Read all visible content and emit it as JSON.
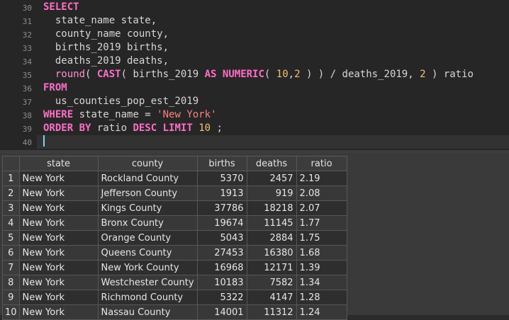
{
  "editor": {
    "line_numbers": [
      "30",
      "31",
      "32",
      "33",
      "34",
      "35",
      "36",
      "37",
      "38",
      "39",
      "40"
    ],
    "lines": {
      "l30": {
        "kw": "SELECT"
      },
      "l31": {
        "text": "  state_name state,"
      },
      "l32": {
        "text": "  county_name county,"
      },
      "l33": {
        "text": "  births_2019 births,"
      },
      "l34": {
        "text": "  deaths_2019 deaths,"
      },
      "l35": {
        "p1": "  ",
        "fn": "round",
        "p2": "( ",
        "kw1": "CAST",
        "p3": "( births_2019 ",
        "kw2": "AS",
        "p4": " ",
        "kw3": "NUMERIC",
        "p5": "( ",
        "n1": "10",
        "p6": ",",
        "n2": "2",
        "p7": " ) ) / deaths_2019, ",
        "n3": "2",
        "p8": " ) ratio"
      },
      "l36": {
        "kw": "FROM"
      },
      "l37": {
        "text": "  us_counties_pop_est_2019"
      },
      "l38": {
        "kw": "WHERE",
        "mid": " state_name = ",
        "str": "'New York'"
      },
      "l39": {
        "kw1": "ORDER BY",
        "mid": " ratio ",
        "kw2": "DESC",
        "sp": " ",
        "kw3": "LIMIT",
        "sp2": " ",
        "num": "10",
        "end": " ;"
      }
    }
  },
  "results": {
    "columns": [
      "state",
      "county",
      "births",
      "deaths",
      "ratio"
    ],
    "rows": [
      {
        "n": "1",
        "state": "New York",
        "county": "Rockland County",
        "births": "5370",
        "deaths": "2457",
        "ratio": "2.19"
      },
      {
        "n": "2",
        "state": "New York",
        "county": "Jefferson County",
        "births": "1913",
        "deaths": "919",
        "ratio": "2.08"
      },
      {
        "n": "3",
        "state": "New York",
        "county": "Kings County",
        "births": "37786",
        "deaths": "18218",
        "ratio": "2.07"
      },
      {
        "n": "4",
        "state": "New York",
        "county": "Bronx County",
        "births": "19674",
        "deaths": "11145",
        "ratio": "1.77"
      },
      {
        "n": "5",
        "state": "New York",
        "county": "Orange County",
        "births": "5043",
        "deaths": "2884",
        "ratio": "1.75"
      },
      {
        "n": "6",
        "state": "New York",
        "county": "Queens County",
        "births": "27453",
        "deaths": "16380",
        "ratio": "1.68"
      },
      {
        "n": "7",
        "state": "New York",
        "county": "New York County",
        "births": "16968",
        "deaths": "12171",
        "ratio": "1.39"
      },
      {
        "n": "8",
        "state": "New York",
        "county": "Westchester County",
        "births": "10183",
        "deaths": "7582",
        "ratio": "1.34"
      },
      {
        "n": "9",
        "state": "New York",
        "county": "Richmond County",
        "births": "5322",
        "deaths": "4147",
        "ratio": "1.28"
      },
      {
        "n": "10",
        "state": "New York",
        "county": "Nassau County",
        "births": "14001",
        "deaths": "11312",
        "ratio": "1.24"
      }
    ]
  }
}
